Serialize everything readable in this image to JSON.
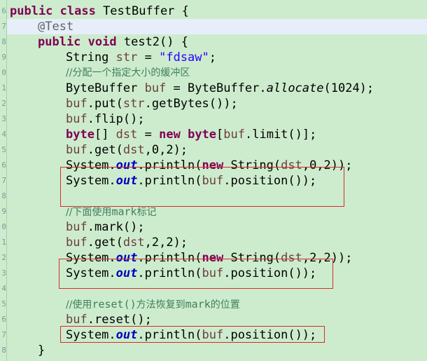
{
  "line_numbers": [
    "6",
    "7",
    "8",
    "9",
    "0",
    "1",
    "2",
    "3",
    "4",
    "5",
    "6",
    "7",
    "8",
    "9",
    "0",
    "1",
    "2",
    "3",
    "4",
    "5",
    "6",
    "7",
    "8"
  ],
  "code": {
    "class_decl": {
      "kw": "public class",
      "name": " TestBuffer {"
    },
    "annotation": "@Test",
    "method_decl": {
      "kw1": "public",
      "kw2": "void",
      "rest": " test2() {"
    },
    "str_decl": {
      "type": "String",
      "var": "str",
      "eq": " = ",
      "literal": "\"fdsaw\"",
      "end": ";"
    },
    "comment_alloc": "//分配一个指定大小的缓冲区",
    "alloc_line": {
      "a": "ByteBuffer ",
      "var": "buf",
      "b": " = ByteBuffer.",
      "method": "allocate",
      "c": "(1024);"
    },
    "put_line": {
      "var": "buf",
      "rest": ".put(",
      "var2": "str",
      "rest2": ".getBytes());"
    },
    "flip_line": {
      "var": "buf",
      "rest": ".flip();"
    },
    "dst_line": {
      "kw": "byte",
      "a": "[] ",
      "var": "dst",
      "b": " = ",
      "kw2": "new",
      "c": " ",
      "kw3": "byte",
      "d": "[",
      "var2": "buf",
      "e": ".limit()];"
    },
    "get1_line": {
      "var": "buf",
      "a": ".get(",
      "var2": "dst",
      "b": ",0,2);"
    },
    "println_new1": {
      "a": "System.",
      "fld": "out",
      "b": ".println(",
      "kw": "new",
      "c": " String(",
      "var": "dst",
      "d": ",0,2));"
    },
    "println_pos1": {
      "a": "System.",
      "fld": "out",
      "b": ".println(",
      "var": "buf",
      "c": ".position());"
    },
    "comment_mark_pre": "//下面使用",
    "comment_mark_kw": "mark",
    "comment_mark_post": "标记",
    "mark_line": {
      "var": "buf",
      "rest": ".mark();"
    },
    "get2_line": {
      "var": "buf",
      "a": ".get(",
      "var2": "dst",
      "b": ",2,2);"
    },
    "println_new2": {
      "a": "System.",
      "fld": "out",
      "b": ".println(",
      "kw": "new",
      "c": " String(",
      "var": "dst",
      "d": ",2,2));"
    },
    "println_pos2": {
      "a": "System.",
      "fld": "out",
      "b": ".println(",
      "var": "buf",
      "c": ".position());"
    },
    "comment_reset_pre": "//使用",
    "comment_reset_kw": "reset()",
    "comment_reset_mid": "方法恢复到",
    "comment_reset_kw2": "mark",
    "comment_reset_post": "的位置",
    "reset_line": {
      "var": "buf",
      "rest": ".reset();"
    },
    "println_pos3": {
      "a": "System.",
      "fld": "out",
      "b": ".println(",
      "var": "buf",
      "c": ".position());"
    },
    "close_brace": "}"
  },
  "colors": {
    "background": "#cdeccd",
    "keyword": "#7f0055",
    "string": "#2a00ff",
    "comment": "#3f7f5f",
    "field": "#0000c0",
    "highlight_box": "#d62b2b"
  }
}
